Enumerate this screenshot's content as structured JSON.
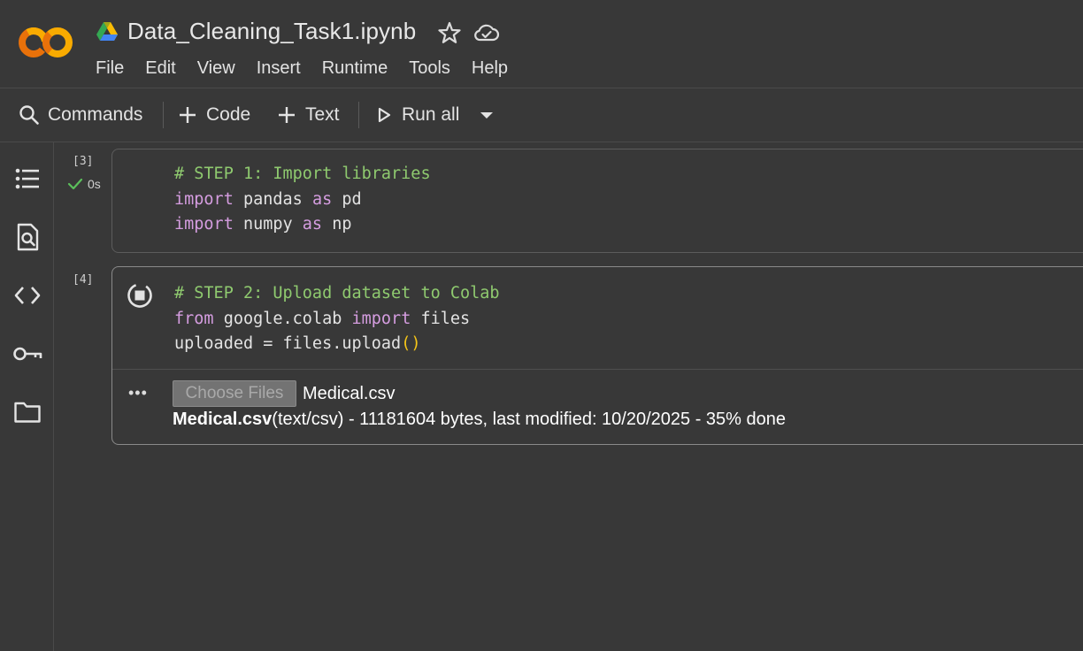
{
  "header": {
    "title": "Data_Cleaning_Task1.ipynb",
    "logo_text": "CO",
    "icons": [
      "colab-logo",
      "google-drive-icon",
      "star-icon",
      "cloud-sync-icon"
    ],
    "menu": [
      "File",
      "Edit",
      "View",
      "Insert",
      "Runtime",
      "Tools",
      "Help"
    ]
  },
  "toolbar": {
    "commands_label": "Commands",
    "code_label": "Code",
    "text_label": "Text",
    "run_all_label": "Run all"
  },
  "sidebar": {
    "icons": [
      "table-of-contents-icon",
      "find-icon",
      "code-snippets-icon",
      "secrets-key-icon",
      "files-folder-icon"
    ]
  },
  "cells": [
    {
      "exec_count": "[3]",
      "status": "0s",
      "lines": [
        {
          "comment": "# STEP 1: Import libraries"
        },
        {
          "kw1": "import",
          "t1": " pandas ",
          "kw2": "as",
          "t2": " pd"
        },
        {
          "kw1": "import",
          "t1": " numpy ",
          "kw2": "as",
          "t2": " np"
        }
      ]
    },
    {
      "exec_count": "[4]",
      "lines": [
        {
          "comment": "# STEP 2: Upload dataset to Colab"
        },
        {
          "kw1": "from",
          "t1": " google.colab ",
          "kw2": "import",
          "t2": " files"
        },
        {
          "t1": "uploaded = files.upload",
          "p1": "(",
          "p2": ")"
        }
      ],
      "output": {
        "more_label": "•••",
        "choose_files_label": "Choose Files",
        "selected_file": "Medical.csv",
        "progress_file": "Medical.csv",
        "progress_rest": "(text/csv) - 11181604 bytes, last modified: 10/20/2025 - 35% done"
      }
    }
  ],
  "colors": {
    "background": "#383838",
    "comment": "#8fca6f",
    "keyword": "#d59de0",
    "paren": "#f5c518",
    "check": "#5bbf5b",
    "logo_orange": "#f9ab00",
    "logo_dark_orange": "#e8710a"
  }
}
